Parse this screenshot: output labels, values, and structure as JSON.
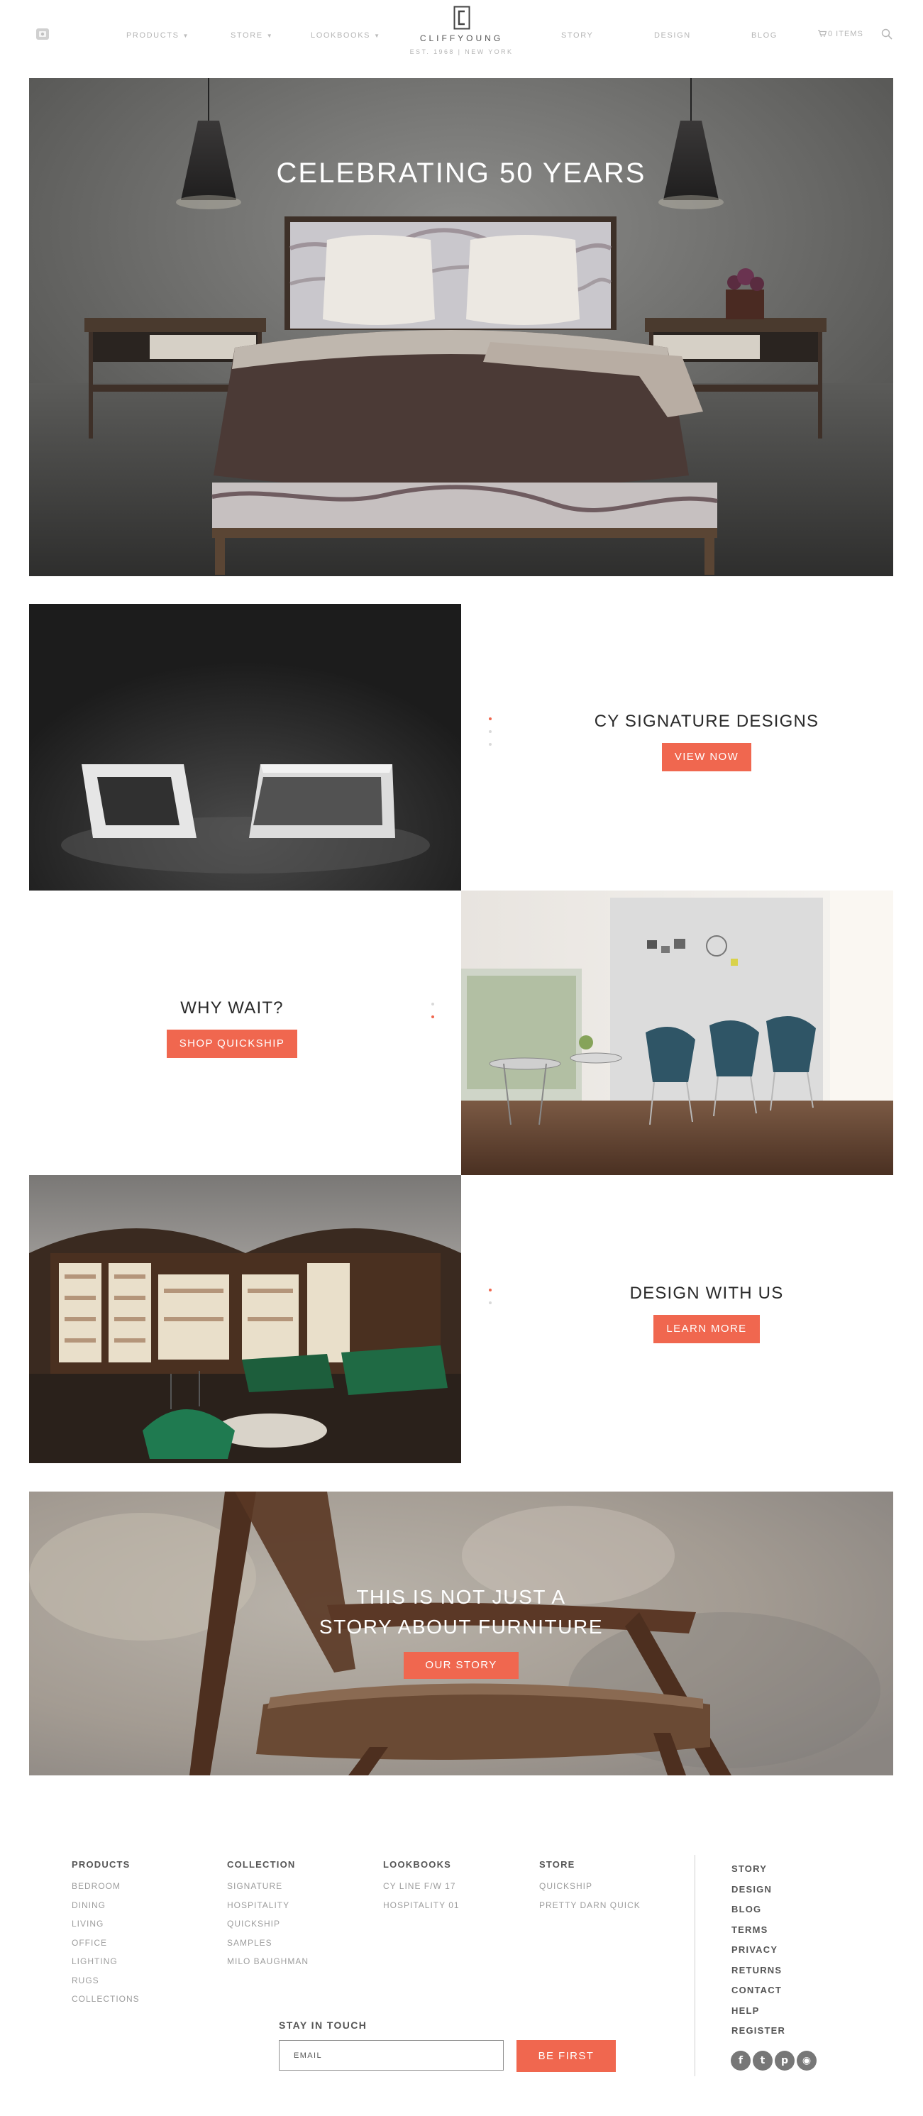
{
  "header": {
    "nav": [
      {
        "label": "PRODUCTS",
        "dropdown": true
      },
      {
        "label": "STORE",
        "dropdown": true
      },
      {
        "label": "LOOKBOOKS",
        "dropdown": true
      },
      {
        "label": "STORY",
        "dropdown": false
      },
      {
        "label": "DESIGN",
        "dropdown": false
      },
      {
        "label": "BLOG",
        "dropdown": false
      }
    ],
    "logo": {
      "name": "CLIFFYOUNG",
      "established": "EST. 1968 | NEW YORK"
    },
    "cart": "0 ITEMS"
  },
  "hero": {
    "title": "CELEBRATING 50 YEARS"
  },
  "tiles": [
    {
      "heading": "CY SIGNATURE DESIGNS",
      "button": "VIEW NOW"
    },
    {
      "heading": "WHY WAIT?",
      "button": "SHOP QUICKSHIP"
    },
    {
      "heading": "DESIGN WITH US",
      "button": "LEARN MORE"
    }
  ],
  "story": {
    "lines": [
      "THIS IS NOT JUST A",
      "STORY ABOUT FURNITURE"
    ],
    "button": "OUR STORY"
  },
  "footer": {
    "columns": [
      {
        "heading": "PRODUCTS",
        "links": [
          "BEDROOM",
          "DINING",
          "LIVING",
          "OFFICE",
          "LIGHTING",
          "RUGS",
          "COLLECTIONS"
        ]
      },
      {
        "heading": "COLLECTION",
        "links": [
          "SIGNATURE",
          "HOSPITALITY",
          "QUICKSHIP",
          "SAMPLES",
          "MILO BAUGHMAN"
        ]
      },
      {
        "heading": "LOOKBOOKS",
        "links": [
          "CY LINE F/W 17",
          "HOSPITALITY 01"
        ]
      },
      {
        "heading": "STORE",
        "links": [
          "QUICKSHIP",
          "PRETTY DARN QUICK"
        ]
      }
    ],
    "right_links": [
      "STORY",
      "DESIGN",
      "BLOG",
      "TERMS",
      "PRIVACY",
      "RETURNS",
      "CONTACT",
      "HELP",
      "REGISTER"
    ],
    "social": [
      "facebook-icon",
      "twitter-icon",
      "pinterest-icon",
      "instagram-icon"
    ],
    "newsletter": {
      "heading": "STAY IN TOUCH",
      "placeholder": "EMAIL",
      "button": "BE FIRST"
    }
  },
  "colors": {
    "accent": "#f0674f",
    "nav_text": "#b5b5b5",
    "heading_text": "#2a2a2a"
  }
}
